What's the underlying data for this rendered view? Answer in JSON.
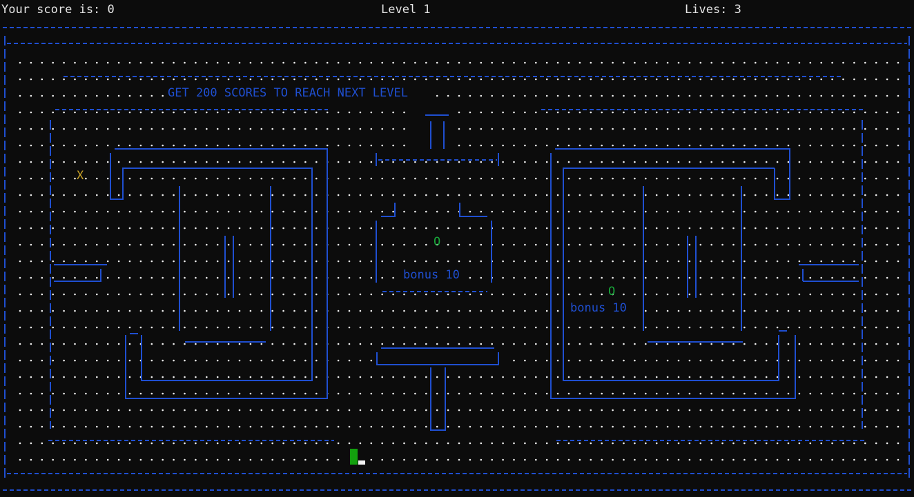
{
  "hud": {
    "score_label": "Your score is: 0",
    "level_label": "Level 1",
    "lives_label": "Lives: 3"
  },
  "message": "GET 200 SCORES TO REACH NEXT LEVEL",
  "bonuses": [
    {
      "label": "bonus 10"
    },
    {
      "label": "bonus 10"
    }
  ],
  "pickups": {
    "center": "O",
    "right": "O"
  },
  "enemy": "X",
  "colors": {
    "background": "#0c0c0c",
    "wall": "#1f4fd1",
    "pellet": "#f2f2f2",
    "player": "#13a10e",
    "pickup": "#18a83a",
    "enemy": "#c9a227",
    "hud_text": "#e6e6e6"
  }
}
